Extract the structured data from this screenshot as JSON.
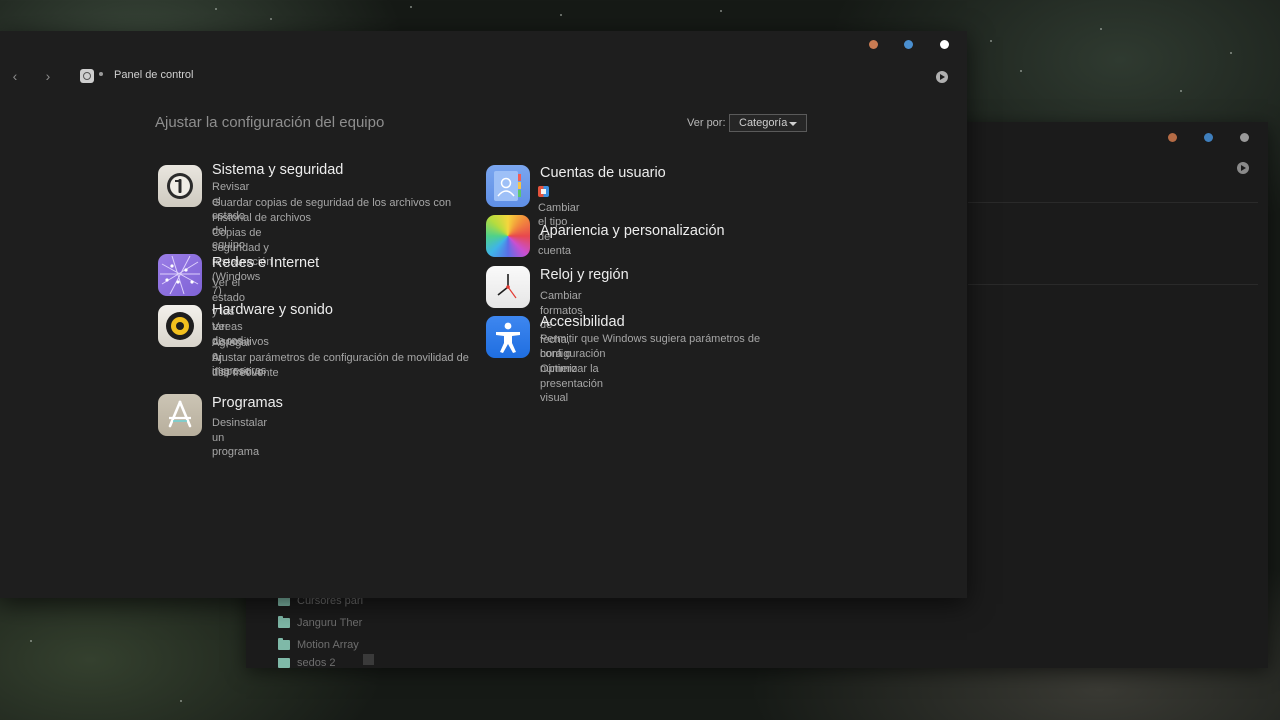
{
  "main_window": {
    "title_dots": {
      "orange": "#c97b52",
      "blue": "#4a8fd0",
      "white": "#ffffff"
    },
    "breadcrumb": "Panel de control",
    "page_title": "Ajustar la configuración del equipo",
    "view_by": {
      "label": "Ver por:",
      "value": "Categoría"
    }
  },
  "categories_left": [
    {
      "title": "Sistema y seguridad",
      "icon": "security-key-icon",
      "links": [
        "Revisar el estado del equipo",
        "Guardar copias de seguridad de los archivos con Historial de archivos",
        "Copias de seguridad y restauración (Windows 7)"
      ]
    },
    {
      "title": "Redes e Internet",
      "icon": "network-globe-icon",
      "links": [
        "Ver el estado y las tareas de red"
      ]
    },
    {
      "title": "Hardware y sonido",
      "icon": "speaker-icon",
      "links": [
        "Ver dispositivos e impresoras",
        "Agregar un dispositivo",
        "Ajustar parámetros de configuración de movilidad de uso frecuente"
      ]
    },
    {
      "title": "Programas",
      "icon": "app-store-icon",
      "links": [
        "Desinstalar un programa"
      ]
    }
  ],
  "categories_right": [
    {
      "title": "Cuentas de usuario",
      "icon": "contacts-icon",
      "links": [
        "Cambiar el tipo de cuenta"
      ]
    },
    {
      "title": "Apariencia y personalización",
      "icon": "color-palette-icon",
      "links": []
    },
    {
      "title": "Reloj y región",
      "icon": "clock-icon",
      "links": [
        "Cambiar formatos de fecha, hora o número"
      ]
    },
    {
      "title": "Accesibilidad",
      "icon": "accessibility-icon",
      "links": [
        "Permitir que Windows sugiera parámetros de configuración",
        "Optimizar la presentación visual"
      ]
    }
  ],
  "background_window": {
    "folders": [
      "Cursores pari",
      "Janguru Ther",
      "Motion Array",
      "sedos 2"
    ]
  }
}
